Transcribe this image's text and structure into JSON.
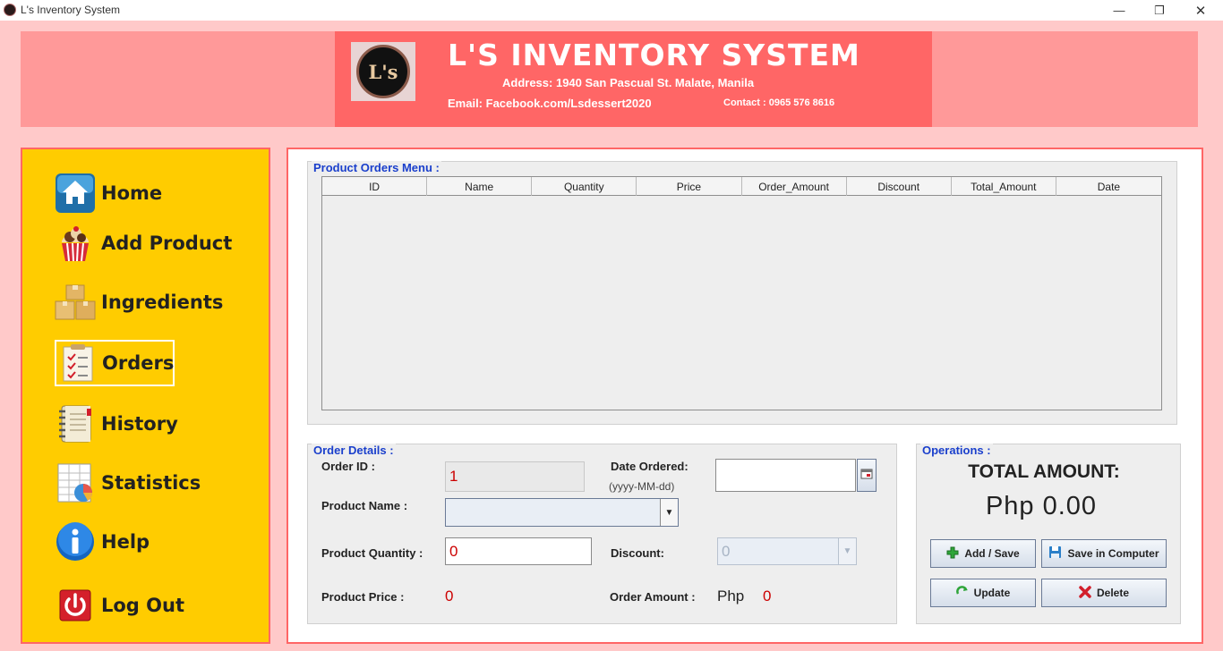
{
  "window": {
    "title": "L's Inventory System",
    "minimize_icon": "—",
    "restore_icon": "❐",
    "close_icon": "✕"
  },
  "header": {
    "logo_text": "L's",
    "title": "L'S INVENTORY SYSTEM",
    "address": "Address: 1940 San Pascual St. Malate, Manila",
    "email": "Email: Facebook.com/Lsdessert2020",
    "contact": "Contact : 0965 576 8616"
  },
  "sidebar": {
    "items": [
      {
        "label": "Home",
        "icon": "home-icon"
      },
      {
        "label": "Add Product",
        "icon": "cupcake-icon"
      },
      {
        "label": "Ingredients",
        "icon": "boxes-icon"
      },
      {
        "label": "Orders",
        "icon": "clipboard-checklist-icon",
        "active": true
      },
      {
        "label": "History",
        "icon": "notebook-icon"
      },
      {
        "label": "Statistics",
        "icon": "spreadsheet-chart-icon"
      },
      {
        "label": "Help",
        "icon": "info-icon"
      },
      {
        "label": "Log Out",
        "icon": "power-icon"
      }
    ]
  },
  "orders_table": {
    "title": "Product Orders Menu :",
    "columns": [
      "ID",
      "Name",
      "Quantity",
      "Price",
      "Order_Amount",
      "Discount",
      "Total_Amount",
      "Date"
    ],
    "rows": []
  },
  "order_details": {
    "title": "Order Details :",
    "order_id_label": "Order ID :",
    "order_id_value": "1",
    "date_label": "Date Ordered:",
    "date_format": "(yyyy-MM-dd)",
    "date_value": "",
    "product_name_label": "Product Name :",
    "product_name_value": "",
    "quantity_label": "Product Quantity :",
    "quantity_value": "0",
    "discount_label": "Discount:",
    "discount_value": "0",
    "price_label": "Product Price :",
    "price_value": "0",
    "order_amount_label": "Order Amount :",
    "currency": "Php",
    "order_amount_value": "0"
  },
  "operations": {
    "title": "Operations :",
    "total_label": "TOTAL AMOUNT:",
    "total_value": "Php 0.00",
    "buttons": {
      "add_save": "Add / Save",
      "save_computer": "Save in Computer",
      "update": "Update",
      "delete": "Delete"
    }
  },
  "colors": {
    "background": "#ffc9c9",
    "header_band": "#ff9999",
    "header_center": "#ff6666",
    "sidebar": "#ffcc00",
    "group_title": "#1a3fcc",
    "value_red": "#cc0000"
  }
}
